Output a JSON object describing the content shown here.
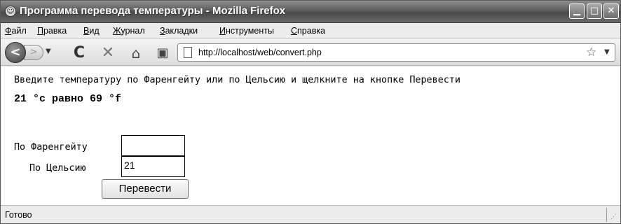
{
  "window": {
    "title": "Программа перевода температуры - Mozilla Firefox",
    "min_symbol": "▁",
    "max_symbol": "□",
    "close_symbol": "✕"
  },
  "menu": {
    "items": [
      {
        "underline": "Ф",
        "rest": "айл"
      },
      {
        "underline": "П",
        "rest": "равка"
      },
      {
        "underline": "В",
        "rest": "ид"
      },
      {
        "underline": "Ж",
        "rest": "урнал"
      },
      {
        "underline": "З",
        "rest": "акладки"
      },
      {
        "underline": "И",
        "rest": "нструменты"
      },
      {
        "underline": "С",
        "rest": "правка"
      }
    ]
  },
  "toolbar": {
    "icons": [
      "back-icon",
      "forward-icon",
      "reload-icon",
      "stop-icon",
      "home-icon",
      "new-bookmark-icon",
      "star-icon"
    ],
    "url": "http://localhost/web/convert.php"
  },
  "content": {
    "instructions": "Введите температуру по Фаренгейту или по Цельсию и щелкните на кнопке Перевести",
    "result": "21 °c равно 69 °f",
    "fahrenheit_label": "По Фаренгейту",
    "celsius_label": "По Цельсию",
    "fahrenheit_value": "",
    "celsius_value": "21",
    "convert_button": "Перевести"
  },
  "status": {
    "text": "Готово"
  }
}
